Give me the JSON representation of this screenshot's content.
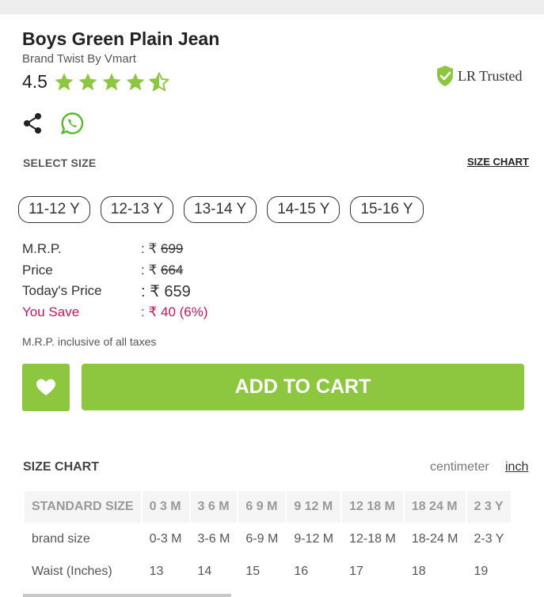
{
  "product": {
    "title": "Boys Green Plain Jean",
    "brand": "Brand Twist By Vmart",
    "rating": "4.5",
    "rating_value": 4.5,
    "rating_max": 5
  },
  "trusted": {
    "label": "LR Trusted"
  },
  "icons": {
    "share": "share-icon",
    "whatsapp": "whatsapp-icon",
    "heart": "heart-icon",
    "badge": "shield-check-icon"
  },
  "colors": {
    "accent": "#8dc63f",
    "save": "#c2185b"
  },
  "size_select": {
    "heading": "SELECT SIZE",
    "chart_link": "SIZE CHART",
    "sizes": [
      "11-12 Y",
      "12-13 Y",
      "13-14 Y",
      "14-15 Y",
      "15-16 Y"
    ]
  },
  "pricing": {
    "mrp_label": "M.R.P.",
    "mrp_value": ": ₹ ",
    "mrp_amount": "699",
    "price_label": "Price",
    "price_prefix": ": ₹ ",
    "price_amount": "664",
    "today_label": "Today's Price",
    "today_value": ": ₹ 659",
    "save_label": "You Save",
    "save_value": ": ₹ 40 (6%)",
    "tax_note": "M.R.P. inclusive of all taxes"
  },
  "actions": {
    "add_to_cart": "ADD TO CART"
  },
  "size_chart": {
    "title": "SIZE CHART",
    "unit_cm": "centimeter",
    "unit_inch": "inch",
    "headers": [
      "STANDARD SIZE",
      "0 3 M",
      "3 6 M",
      "6 9 M",
      "9 12 M",
      "12 18 M",
      "18 24 M",
      "2 3 Y"
    ],
    "rows": [
      [
        "brand size",
        "0-3 M",
        "3-6 M",
        "6-9 M",
        "9-12 M",
        "12-18 M",
        "18-24 M",
        "2-3 Y"
      ],
      [
        "Waist (Inches)",
        "13",
        "14",
        "15",
        "16",
        "17",
        "18",
        "19"
      ]
    ]
  }
}
